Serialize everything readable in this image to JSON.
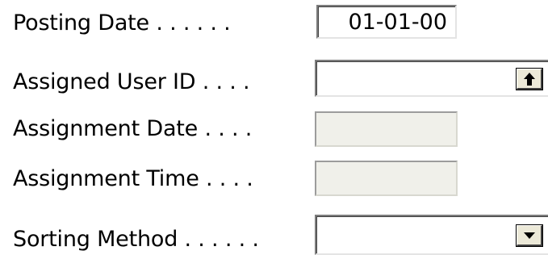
{
  "form": {
    "posting_date": {
      "label": "Posting Date . . . . . .",
      "value": "01-01-00"
    },
    "assigned_user_id": {
      "label": "Assigned User ID . . . .",
      "value": "",
      "button_icon": "lookup-arrow-up-icon"
    },
    "assignment_date": {
      "label": "Assignment Date . . . .",
      "value": ""
    },
    "assignment_time": {
      "label": "Assignment Time . . . .",
      "value": ""
    },
    "sorting_method": {
      "label": "Sorting Method . . . . . .",
      "value": "",
      "button_icon": "dropdown-arrow-down-icon"
    }
  },
  "colors": {
    "background": "#ffffff",
    "disabled_field": "#f0f0ea",
    "button_face": "#ece9d8"
  }
}
